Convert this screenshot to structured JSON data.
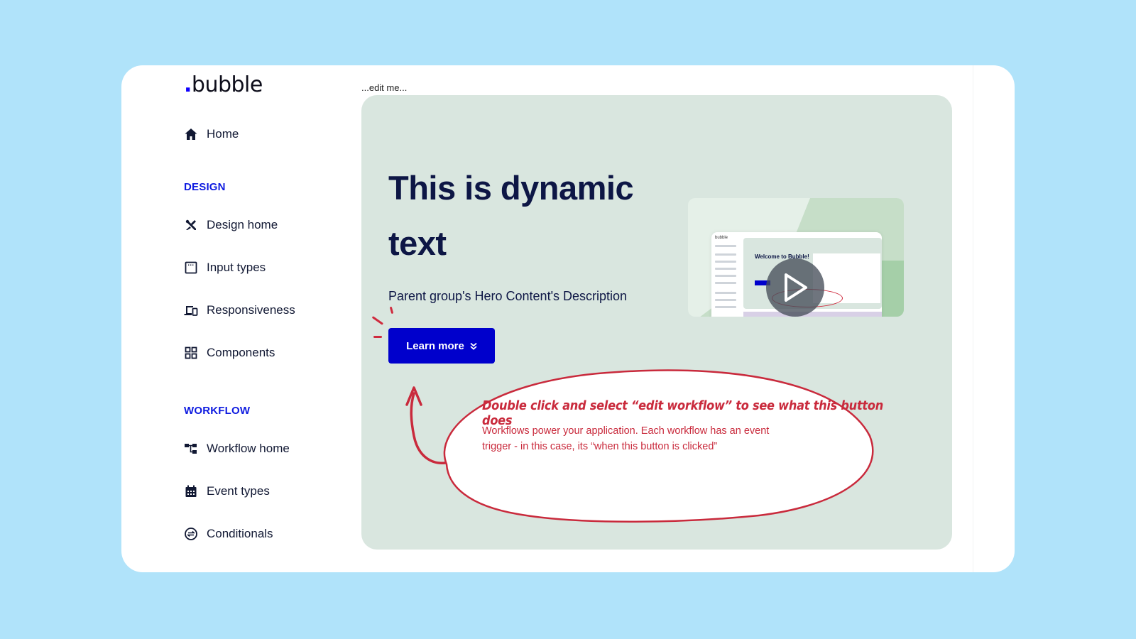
{
  "brand": {
    "logo_dot": ".",
    "logo_text": "bubble",
    "accent": "#0f00ff"
  },
  "sidebar": {
    "home": {
      "label": "Home",
      "icon": "home-icon"
    },
    "sections": [
      {
        "title": "DESIGN",
        "items": [
          {
            "label": "Design home",
            "icon": "design-tools-icon"
          },
          {
            "label": "Input types",
            "icon": "input-window-icon"
          },
          {
            "label": "Responsiveness",
            "icon": "devices-icon"
          },
          {
            "label": "Components",
            "icon": "grid-icon"
          }
        ]
      },
      {
        "title": "WORKFLOW",
        "items": [
          {
            "label": "Workflow home",
            "icon": "workflow-tree-icon"
          },
          {
            "label": "Event types",
            "icon": "calendar-icon"
          },
          {
            "label": "Conditionals",
            "icon": "swap-circle-icon"
          }
        ]
      }
    ]
  },
  "main": {
    "edit_me": "...edit me...",
    "hero": {
      "title": "This is dynamic text",
      "description": "Parent group's Hero Content's Description",
      "cta_label": "Learn more",
      "cta_icon": "double-chevron-down-icon",
      "video": {
        "inner_title": "Welcome to Bubble!",
        "inner_logo": "bubble",
        "play_icon": "play-icon"
      }
    },
    "annotation": {
      "title": "Double click and select “edit workflow” to see what this button does",
      "body": "Workflows power your application. Each workflow has an event trigger - in this case, its “when this button is clicked”"
    }
  },
  "colors": {
    "background": "#b0e3fa",
    "hero_bg": "#d9e6df",
    "cta_bg": "#0000cc",
    "section_heading": "#0d1ae0",
    "annotation_red": "#c92a3c",
    "navy_text": "#0d1645"
  }
}
